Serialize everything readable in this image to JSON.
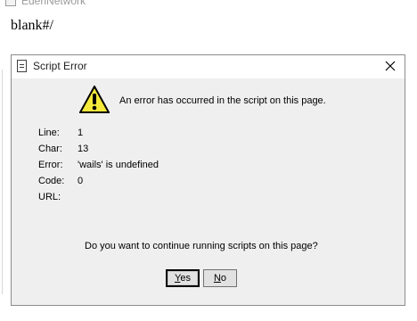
{
  "window": {
    "app_title": "EdenNetwork",
    "page_url": "blank#/"
  },
  "dialog": {
    "title": "Script Error",
    "heading": "An error has occurred in the script on this page.",
    "details": {
      "line_label": "Line:",
      "line_value": "1",
      "char_label": "Char:",
      "char_value": "13",
      "error_label": "Error:",
      "error_value": "'wails' is undefined",
      "code_label": "Code:",
      "code_value": "0",
      "url_label": "URL:",
      "url_value": ""
    },
    "question": "Do you want to continue running scripts on this page?",
    "buttons": {
      "yes_label": "Yes",
      "no_label": "No"
    }
  },
  "icons": {
    "title_icon": "document-icon",
    "close_icon": "close-icon",
    "warning_icon": "warning-icon"
  }
}
